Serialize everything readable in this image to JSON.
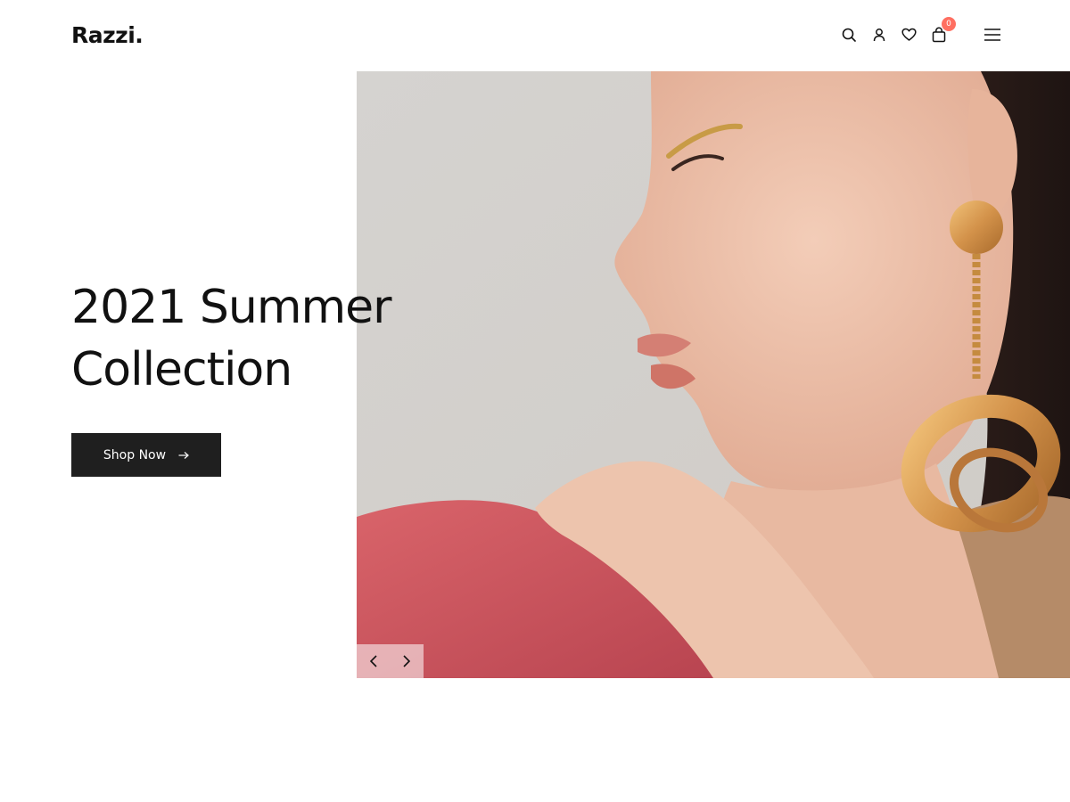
{
  "brand": {
    "logo_text": "Razzi."
  },
  "header": {
    "icons": [
      "search-icon",
      "user-icon",
      "heart-icon",
      "shopping-bag-icon",
      "menu-icon"
    ],
    "cart_count": "0"
  },
  "hero": {
    "title_line_1": "2021 Summer",
    "title_line_2": "Collection",
    "cta_label": "Shop Now",
    "cta_icon": "arrow-right-icon",
    "slider_prev_icon": "chevron-left-icon",
    "slider_next_icon": "chevron-right-icon"
  },
  "colors": {
    "accent_badge": "#ff6f61",
    "button_bg": "#1f1f1f",
    "text": "#111111"
  }
}
